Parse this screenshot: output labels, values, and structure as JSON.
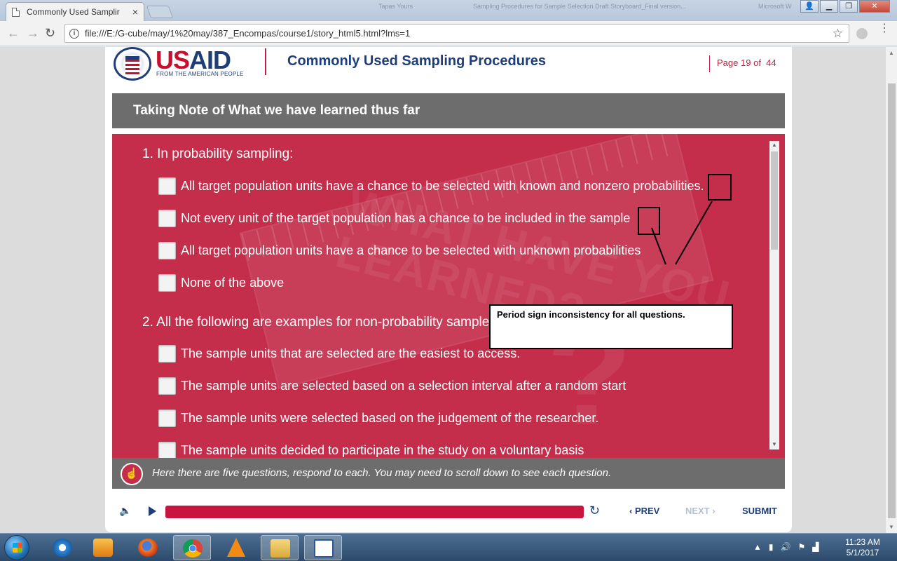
{
  "browser": {
    "tab_title": "Commonly Used Samplir",
    "window_titles": [
      "Tapas Yours",
      "Sampling Procedures for Sample Selection Draft Storyboard_Final version...",
      "Microsoft W"
    ],
    "url": "file:///E:/G-cube/may/1%20may/387_Encompas/course1/story_html5.html?lms=1"
  },
  "header": {
    "logo_word": "USAID",
    "logo_tagline": "FROM THE AMERICAN PEOPLE",
    "course_title": "Commonly Used Sampling Procedures",
    "page_label": "Page",
    "page_current": "19",
    "page_of": "of",
    "page_total": "44"
  },
  "slide": {
    "title": "Taking Note of What we have learned thus far",
    "questions": [
      {
        "text": "1. In probability sampling:",
        "options": [
          "All target population units have a chance to be selected with known and nonzero probabilities.",
          "Not every unit of the target population has a chance to be included in the sample",
          "All target population units have a chance to be selected with unknown probabilities",
          "None of the above"
        ]
      },
      {
        "text": "2. All the following are examples for non-probability samples except:",
        "options": [
          "The sample units that are selected are the easiest to access.",
          "The sample units are selected based on a selection interval after a random start",
          "The sample units were selected based on the judgement of the researcher.",
          "The sample units decided to participate in the study on a voluntary basis"
        ]
      }
    ],
    "background_text": "WHAT HAVE YOU LEARNED?",
    "annotation": "Period sign inconsistency for all questions.",
    "instruction": "Here there are five questions, respond to each. You may need to scroll down to see each question."
  },
  "controls": {
    "progress": 1.0,
    "prev_label": "PREV",
    "next_label": "NEXT",
    "submit_label": "SUBMIT"
  },
  "taskbar": {
    "time": "11:23 AM",
    "date": "5/1/2017"
  },
  "colors": {
    "brand_blue": "#1f3e78",
    "accent_red": "#c42e4b",
    "progress_red": "#c8143e",
    "title_bar_gray": "#6d6d6d"
  }
}
